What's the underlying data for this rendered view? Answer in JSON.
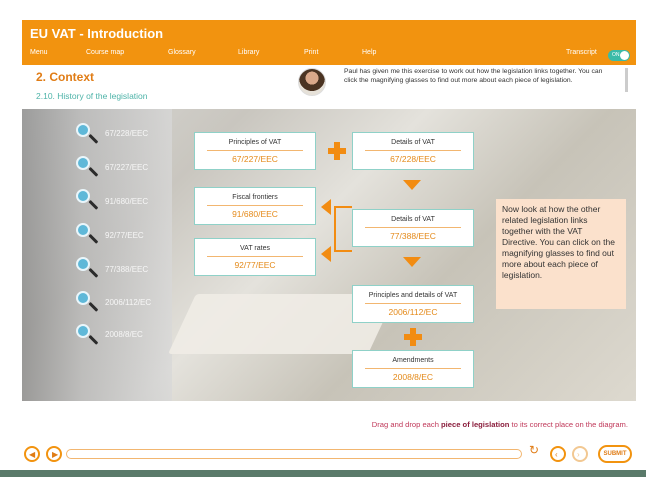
{
  "header": {
    "title": "EU VAT - Introduction",
    "menu": [
      "Menu",
      "Course map",
      "Glossary",
      "Library",
      "Print",
      "Help"
    ],
    "transcript_label": "Transcript",
    "toggle_state": "ON"
  },
  "context": {
    "title": "2. Context",
    "subtitle": "2.10. History of the legislation",
    "speech": "Paul has given me this exercise to work out how the legislation links together. You can click the magnifying glasses to find out more about each piece of legislation."
  },
  "draggables": [
    "67/228/EEC",
    "67/227/EEC",
    "91/680/EEC",
    "92/77/EEC",
    "77/388/EEC",
    "2006/112/EC",
    "2008/8/EC"
  ],
  "diagram": {
    "principles_name": "Principles of VAT",
    "principles_code": "67/227/EEC",
    "details1_name": "Details of VAT",
    "details1_code": "67/228/EEC",
    "fiscal_name": "Fiscal frontiers",
    "fiscal_code": "91/680/EEC",
    "details2_name": "Details of VAT",
    "details2_code": "77/388/EEC",
    "rates_name": "VAT rates",
    "rates_code": "92/77/EEC",
    "pd_name": "Principles and details of VAT",
    "pd_code": "2006/112/EC",
    "amend_name": "Amendments",
    "amend_code": "2008/8/EC"
  },
  "note": "Now look at how the other related legislation links together with the VAT Directive. You can click on the magnifying glasses to find out more about each piece of legislation.",
  "instruction": {
    "pre": "Drag and drop each ",
    "bold": "piece of legislation",
    "post": " to its correct place on the diagram."
  },
  "footer": {
    "submit": "SUBMIT"
  },
  "colors": {
    "brand_orange": "#f2930f",
    "teal": "#4db3a8",
    "note_bg": "#fbe1cc"
  },
  "icons": [
    "volume-icon",
    "play-icon",
    "replay-icon",
    "prev-icon",
    "next-icon",
    "magnifier-icon",
    "plus-icon",
    "chevron-down-icon",
    "chevron-left-icon"
  ]
}
